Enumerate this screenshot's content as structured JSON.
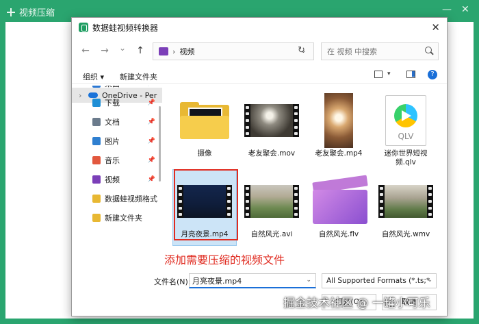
{
  "app": {
    "title": "视频压缩",
    "minimize_glyph": "—",
    "close_glyph": "✕"
  },
  "dialog": {
    "title": "数据蛙视频转换器",
    "close_glyph": "✕",
    "address": {
      "back_glyph": "←",
      "forward_glyph": "→",
      "recent_glyph": "⌄",
      "up_glyph": "↑",
      "separator": "›",
      "path": "视频",
      "chevron": "⌄",
      "refresh_glyph": "↻"
    },
    "search": {
      "placeholder": "在 视频 中搜索"
    },
    "toolbar": {
      "organize": "组织 ▾",
      "new_folder": "新建文件夹",
      "view_dropdown": "▾",
      "help": "?"
    },
    "nav": {
      "onedrive": {
        "caret": "›",
        "label": "OneDrive - Per"
      },
      "items": [
        {
          "label": "桌面",
          "icon": "desktop-icon",
          "color": "#2b78d4",
          "pin": "📌"
        },
        {
          "label": "下载",
          "icon": "download-icon",
          "color": "#1f8fd6",
          "pin": "📌"
        },
        {
          "label": "文档",
          "icon": "document-icon",
          "color": "#6b7b8c",
          "pin": "📌"
        },
        {
          "label": "图片",
          "icon": "pictures-icon",
          "color": "#2f7fd0",
          "pin": "📌"
        },
        {
          "label": "音乐",
          "icon": "music-icon",
          "color": "#e2583e",
          "pin": "📌"
        },
        {
          "label": "视频",
          "icon": "videos-icon",
          "color": "#7b3fb8",
          "pin": "📌"
        },
        {
          "label": "数据蛙视频格式",
          "icon": "folder-icon",
          "color": "#e8b833",
          "pin": ""
        },
        {
          "label": "新建文件夹",
          "icon": "folder-icon",
          "color": "#e8b833",
          "pin": ""
        }
      ]
    },
    "files": [
      {
        "name": "摄像",
        "kind": "folder"
      },
      {
        "name": "老友聚会.mov",
        "kind": "video"
      },
      {
        "name": "老友聚会.mp4",
        "kind": "video-portrait"
      },
      {
        "name": "迷你世界短视频.qlv",
        "kind": "qlv",
        "badge": "QLV"
      },
      {
        "name": "月亮夜景.mp4",
        "kind": "video",
        "selected": true
      },
      {
        "name": "自然风光.avi",
        "kind": "video"
      },
      {
        "name": "自然风光.flv",
        "kind": "clapper"
      },
      {
        "name": "自然风光.wmv",
        "kind": "video"
      }
    ],
    "filename": {
      "label": "文件名(N):",
      "value": "月亮夜景.mp4",
      "chevron": "⌄"
    },
    "filetype": {
      "value": "All Supported Formats (*.ts;*",
      "chevron": "⌄"
    },
    "buttons": {
      "open": "打开(O)",
      "cancel": "取消"
    }
  },
  "annotation": "添加需要压缩的视频文件",
  "watermark": "掘金技术社区 @ 一罐小可乐",
  "colors": {
    "accent": "#2aa56f",
    "annotation": "#e02b20",
    "link": "#1a6fd8"
  }
}
